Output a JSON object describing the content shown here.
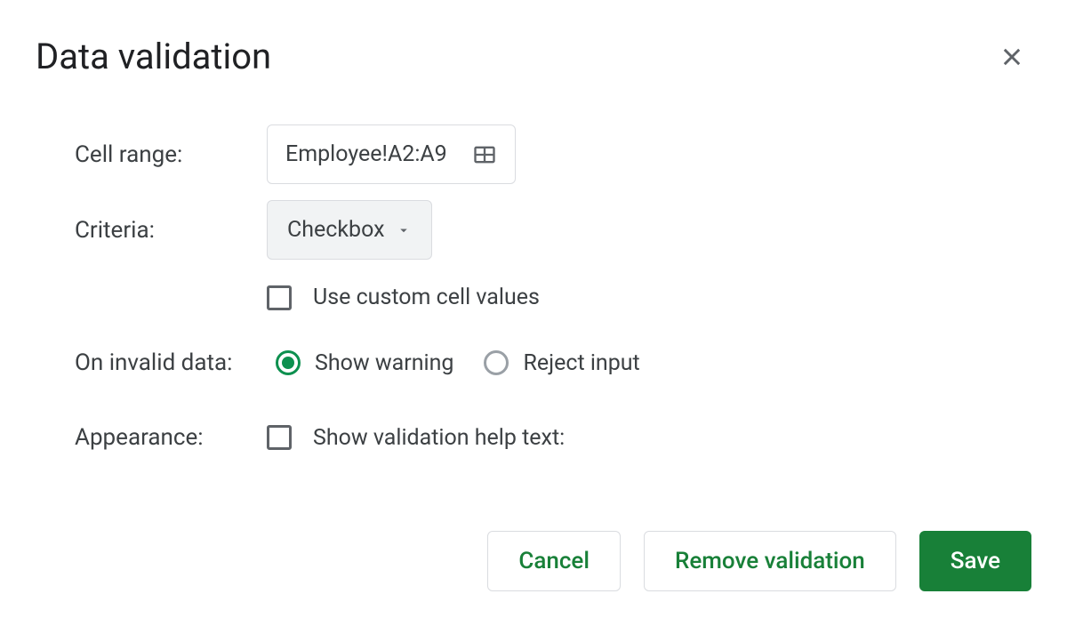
{
  "dialog": {
    "title": "Data validation",
    "cell_range": {
      "label": "Cell range:",
      "value": "Employee!A2:A9"
    },
    "criteria": {
      "label": "Criteria:",
      "selected": "Checkbox",
      "custom_values_label": "Use custom cell values",
      "custom_values_checked": false
    },
    "on_invalid": {
      "label": "On invalid data:",
      "options": [
        {
          "label": "Show warning",
          "selected": true
        },
        {
          "label": "Reject input",
          "selected": false
        }
      ]
    },
    "appearance": {
      "label": "Appearance:",
      "help_text_label": "Show validation help text:",
      "help_text_checked": false
    },
    "buttons": {
      "cancel": "Cancel",
      "remove": "Remove validation",
      "save": "Save"
    }
  }
}
